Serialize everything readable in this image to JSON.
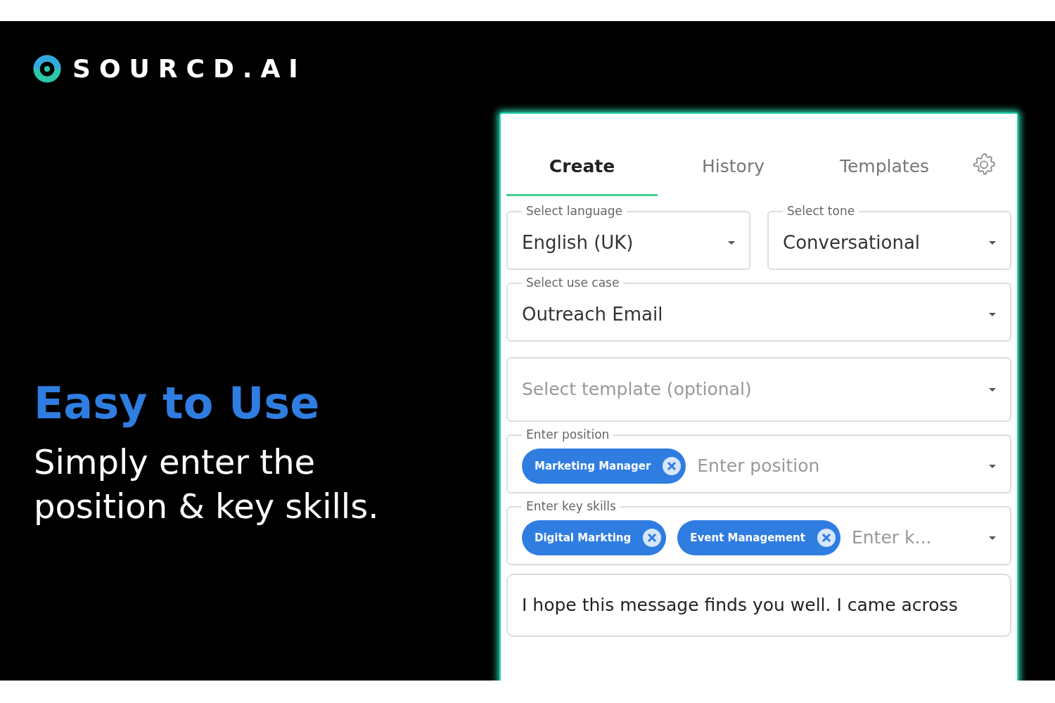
{
  "brand": {
    "name": "SOURCD.AI"
  },
  "headline": "Easy to Use",
  "subheadline": "Simply enter the position & key skills.",
  "tabs": [
    {
      "label": "Create",
      "selected": true
    },
    {
      "label": "History",
      "selected": false
    },
    {
      "label": "Templates",
      "selected": false
    }
  ],
  "field_rows": [
    [
      {
        "kind": "select",
        "label": "Select language",
        "value": "English (UK)"
      },
      {
        "kind": "select",
        "label": "Select tone",
        "value": "Conversational"
      }
    ],
    [
      {
        "kind": "select",
        "label": "Select use case",
        "value": "Outreach Email"
      }
    ],
    [
      {
        "kind": "select",
        "placeholder": "Select template (optional)"
      }
    ],
    [
      {
        "kind": "chips",
        "label": "Enter position",
        "chips": [
          "Marketing Manager"
        ],
        "placeholder": "Enter position"
      }
    ],
    [
      {
        "kind": "chips",
        "label": "Enter key skills",
        "chips": [
          "Digital Markting",
          "Event Management"
        ],
        "placeholder": "Enter k..."
      }
    ]
  ],
  "message": {
    "text": "I hope this message finds you well. I came across"
  }
}
